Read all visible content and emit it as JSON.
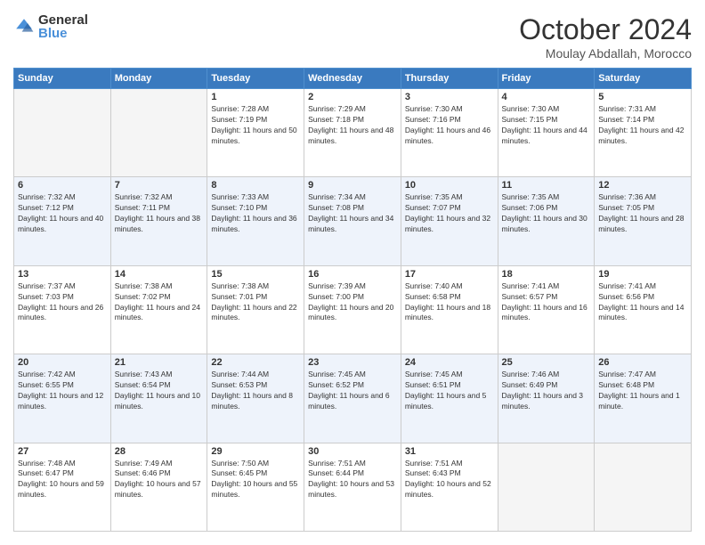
{
  "logo": {
    "general": "General",
    "blue": "Blue"
  },
  "title": "October 2024",
  "subtitle": "Moulay Abdallah, Morocco",
  "days_of_week": [
    "Sunday",
    "Monday",
    "Tuesday",
    "Wednesday",
    "Thursday",
    "Friday",
    "Saturday"
  ],
  "weeks": [
    [
      {
        "num": "",
        "info": ""
      },
      {
        "num": "",
        "info": ""
      },
      {
        "num": "1",
        "info": "Sunrise: 7:28 AM\nSunset: 7:19 PM\nDaylight: 11 hours and 50 minutes."
      },
      {
        "num": "2",
        "info": "Sunrise: 7:29 AM\nSunset: 7:18 PM\nDaylight: 11 hours and 48 minutes."
      },
      {
        "num": "3",
        "info": "Sunrise: 7:30 AM\nSunset: 7:16 PM\nDaylight: 11 hours and 46 minutes."
      },
      {
        "num": "4",
        "info": "Sunrise: 7:30 AM\nSunset: 7:15 PM\nDaylight: 11 hours and 44 minutes."
      },
      {
        "num": "5",
        "info": "Sunrise: 7:31 AM\nSunset: 7:14 PM\nDaylight: 11 hours and 42 minutes."
      }
    ],
    [
      {
        "num": "6",
        "info": "Sunrise: 7:32 AM\nSunset: 7:12 PM\nDaylight: 11 hours and 40 minutes."
      },
      {
        "num": "7",
        "info": "Sunrise: 7:32 AM\nSunset: 7:11 PM\nDaylight: 11 hours and 38 minutes."
      },
      {
        "num": "8",
        "info": "Sunrise: 7:33 AM\nSunset: 7:10 PM\nDaylight: 11 hours and 36 minutes."
      },
      {
        "num": "9",
        "info": "Sunrise: 7:34 AM\nSunset: 7:08 PM\nDaylight: 11 hours and 34 minutes."
      },
      {
        "num": "10",
        "info": "Sunrise: 7:35 AM\nSunset: 7:07 PM\nDaylight: 11 hours and 32 minutes."
      },
      {
        "num": "11",
        "info": "Sunrise: 7:35 AM\nSunset: 7:06 PM\nDaylight: 11 hours and 30 minutes."
      },
      {
        "num": "12",
        "info": "Sunrise: 7:36 AM\nSunset: 7:05 PM\nDaylight: 11 hours and 28 minutes."
      }
    ],
    [
      {
        "num": "13",
        "info": "Sunrise: 7:37 AM\nSunset: 7:03 PM\nDaylight: 11 hours and 26 minutes."
      },
      {
        "num": "14",
        "info": "Sunrise: 7:38 AM\nSunset: 7:02 PM\nDaylight: 11 hours and 24 minutes."
      },
      {
        "num": "15",
        "info": "Sunrise: 7:38 AM\nSunset: 7:01 PM\nDaylight: 11 hours and 22 minutes."
      },
      {
        "num": "16",
        "info": "Sunrise: 7:39 AM\nSunset: 7:00 PM\nDaylight: 11 hours and 20 minutes."
      },
      {
        "num": "17",
        "info": "Sunrise: 7:40 AM\nSunset: 6:58 PM\nDaylight: 11 hours and 18 minutes."
      },
      {
        "num": "18",
        "info": "Sunrise: 7:41 AM\nSunset: 6:57 PM\nDaylight: 11 hours and 16 minutes."
      },
      {
        "num": "19",
        "info": "Sunrise: 7:41 AM\nSunset: 6:56 PM\nDaylight: 11 hours and 14 minutes."
      }
    ],
    [
      {
        "num": "20",
        "info": "Sunrise: 7:42 AM\nSunset: 6:55 PM\nDaylight: 11 hours and 12 minutes."
      },
      {
        "num": "21",
        "info": "Sunrise: 7:43 AM\nSunset: 6:54 PM\nDaylight: 11 hours and 10 minutes."
      },
      {
        "num": "22",
        "info": "Sunrise: 7:44 AM\nSunset: 6:53 PM\nDaylight: 11 hours and 8 minutes."
      },
      {
        "num": "23",
        "info": "Sunrise: 7:45 AM\nSunset: 6:52 PM\nDaylight: 11 hours and 6 minutes."
      },
      {
        "num": "24",
        "info": "Sunrise: 7:45 AM\nSunset: 6:51 PM\nDaylight: 11 hours and 5 minutes."
      },
      {
        "num": "25",
        "info": "Sunrise: 7:46 AM\nSunset: 6:49 PM\nDaylight: 11 hours and 3 minutes."
      },
      {
        "num": "26",
        "info": "Sunrise: 7:47 AM\nSunset: 6:48 PM\nDaylight: 11 hours and 1 minute."
      }
    ],
    [
      {
        "num": "27",
        "info": "Sunrise: 7:48 AM\nSunset: 6:47 PM\nDaylight: 10 hours and 59 minutes."
      },
      {
        "num": "28",
        "info": "Sunrise: 7:49 AM\nSunset: 6:46 PM\nDaylight: 10 hours and 57 minutes."
      },
      {
        "num": "29",
        "info": "Sunrise: 7:50 AM\nSunset: 6:45 PM\nDaylight: 10 hours and 55 minutes."
      },
      {
        "num": "30",
        "info": "Sunrise: 7:51 AM\nSunset: 6:44 PM\nDaylight: 10 hours and 53 minutes."
      },
      {
        "num": "31",
        "info": "Sunrise: 7:51 AM\nSunset: 6:43 PM\nDaylight: 10 hours and 52 minutes."
      },
      {
        "num": "",
        "info": ""
      },
      {
        "num": "",
        "info": ""
      }
    ]
  ]
}
